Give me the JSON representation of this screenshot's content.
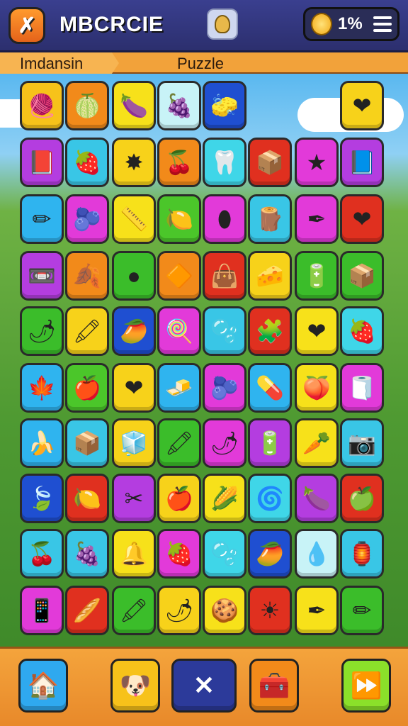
{
  "header": {
    "title": "MBCRCIE",
    "coin_value": "1%",
    "icons": {
      "logo": "x-logo-icon",
      "info": "bulb-icon",
      "coin": "gold-coin-icon",
      "menu": "hamburger-menu-icon"
    }
  },
  "subheader": {
    "level_name": "Imdansin",
    "mode_name": "Puzzle"
  },
  "board": {
    "rows": [
      [
        {
          "color": "#f7c21a",
          "icon": "🧶"
        },
        {
          "color": "#f28a1a",
          "icon": "🍈"
        },
        {
          "color": "#f7e11a",
          "icon": "🍆"
        },
        {
          "color": "#c8f3f7",
          "icon": "🍇"
        },
        {
          "color": "#1f4fd1",
          "icon": "🧽"
        },
        null,
        null,
        {
          "color": "#f7d21a",
          "icon": "❤"
        }
      ],
      [
        {
          "color": "#b43de0",
          "icon": "📕"
        },
        {
          "color": "#39c6e6",
          "icon": "🍓"
        },
        {
          "color": "#f7d21a",
          "icon": "✸"
        },
        {
          "color": "#f28a1a",
          "icon": "🍒"
        },
        {
          "color": "#3fd6e8",
          "icon": "🦷"
        },
        {
          "color": "#e0301f",
          "icon": "📦"
        },
        {
          "color": "#e23ad9",
          "icon": "★"
        },
        {
          "color": "#b43de0",
          "icon": "📘"
        }
      ],
      [
        {
          "color": "#2fb4ef",
          "icon": "✏"
        },
        {
          "color": "#e23ad9",
          "icon": "🫐"
        },
        {
          "color": "#f7e11a",
          "icon": "📏"
        },
        {
          "color": "#4bc62a",
          "icon": "🍋"
        },
        {
          "color": "#e23ad9",
          "icon": "⬮"
        },
        {
          "color": "#39c6e6",
          "icon": "🪵"
        },
        {
          "color": "#e23ad9",
          "icon": "✒"
        },
        {
          "color": "#e0301f",
          "icon": "❤"
        }
      ],
      [
        {
          "color": "#b43de0",
          "icon": "📼"
        },
        {
          "color": "#f28a1a",
          "icon": "🍂"
        },
        {
          "color": "#3bbd2a",
          "icon": "●"
        },
        {
          "color": "#f28a1a",
          "icon": "🔶"
        },
        {
          "color": "#e0301f",
          "icon": "👜"
        },
        {
          "color": "#f7d21a",
          "icon": "🧀"
        },
        {
          "color": "#3bbd2a",
          "icon": "🔋"
        },
        {
          "color": "#3bbd2a",
          "icon": "📦"
        }
      ],
      [
        {
          "color": "#3bbd2a",
          "icon": "🌶"
        },
        {
          "color": "#f7d21a",
          "icon": "🖍"
        },
        {
          "color": "#1f4fd1",
          "icon": "🥭"
        },
        {
          "color": "#e23ad9",
          "icon": "🍭"
        },
        {
          "color": "#39c6e6",
          "icon": "🫧"
        },
        {
          "color": "#e0301f",
          "icon": "🧩"
        },
        {
          "color": "#f7e11a",
          "icon": "❤"
        },
        {
          "color": "#3fd6e8",
          "icon": "🍓"
        }
      ],
      [
        {
          "color": "#2fb4ef",
          "icon": "🍁"
        },
        {
          "color": "#4bc62a",
          "icon": "🍎"
        },
        {
          "color": "#f7d21a",
          "icon": "❤"
        },
        {
          "color": "#2fb4ef",
          "icon": "🧈"
        },
        {
          "color": "#e23ad9",
          "icon": "🫐"
        },
        {
          "color": "#2fb4ef",
          "icon": "💊"
        },
        {
          "color": "#f7e11a",
          "icon": "🍑"
        },
        {
          "color": "#e23ad9",
          "icon": "🧻"
        }
      ],
      [
        {
          "color": "#2fb4ef",
          "icon": "🍌"
        },
        {
          "color": "#39c6e6",
          "icon": "📦"
        },
        {
          "color": "#f7d21a",
          "icon": "🧊"
        },
        {
          "color": "#3bbd2a",
          "icon": "🖍"
        },
        {
          "color": "#e23ad9",
          "icon": "🌶"
        },
        {
          "color": "#b43de0",
          "icon": "🔋"
        },
        {
          "color": "#f7e11a",
          "icon": "🥕"
        },
        {
          "color": "#39c6e6",
          "icon": "📷"
        }
      ],
      [
        {
          "color": "#1f4fd1",
          "icon": "🍃"
        },
        {
          "color": "#e0301f",
          "icon": "🍋"
        },
        {
          "color": "#b43de0",
          "icon": "✂"
        },
        {
          "color": "#f7d21a",
          "icon": "🍎"
        },
        {
          "color": "#f7e11a",
          "icon": "🌽"
        },
        {
          "color": "#3fd6e8",
          "icon": "🌀"
        },
        {
          "color": "#b43de0",
          "icon": "🍆"
        },
        {
          "color": "#e0301f",
          "icon": "🍏"
        }
      ],
      [
        {
          "color": "#39c6e6",
          "icon": "🍒"
        },
        {
          "color": "#39c6e6",
          "icon": "🍇"
        },
        {
          "color": "#f7e11a",
          "icon": "🔔"
        },
        {
          "color": "#e23ad9",
          "icon": "🍓"
        },
        {
          "color": "#3fd6e8",
          "icon": "🫧"
        },
        {
          "color": "#1f4fd1",
          "icon": "🥭"
        },
        {
          "color": "#c8f3f7",
          "icon": "💧"
        },
        {
          "color": "#39c6e6",
          "icon": "🏮"
        }
      ],
      [
        {
          "color": "#e23ad9",
          "icon": "📱"
        },
        {
          "color": "#e0301f",
          "icon": "🥖"
        },
        {
          "color": "#3bbd2a",
          "icon": "🖍"
        },
        {
          "color": "#f7d21a",
          "icon": "🌶"
        },
        {
          "color": "#f7e11a",
          "icon": "🍪"
        },
        {
          "color": "#e0301f",
          "icon": "☀"
        },
        {
          "color": "#f7e11a",
          "icon": "✒"
        },
        {
          "color": "#3bbd2a",
          "icon": "✏"
        }
      ]
    ]
  },
  "footer": {
    "buttons": [
      {
        "name": "home-button",
        "icon": "🏠",
        "icon_name": "home-icon",
        "color": "#2fa9ef"
      },
      {
        "name": "character-button",
        "icon": "🐶",
        "icon_name": "dog-face-icon",
        "color": "#f7c21a"
      },
      {
        "name": "close-button",
        "icon": "✕",
        "icon_name": "close-icon",
        "color": "#2c3a9a"
      },
      {
        "name": "shop-button",
        "icon": "🧰",
        "icon_name": "chest-icon",
        "color": "#f28a1a"
      },
      {
        "name": "next-button",
        "icon": "⏩",
        "icon_name": "fast-forward-icon",
        "color": "#8be02a"
      }
    ]
  }
}
